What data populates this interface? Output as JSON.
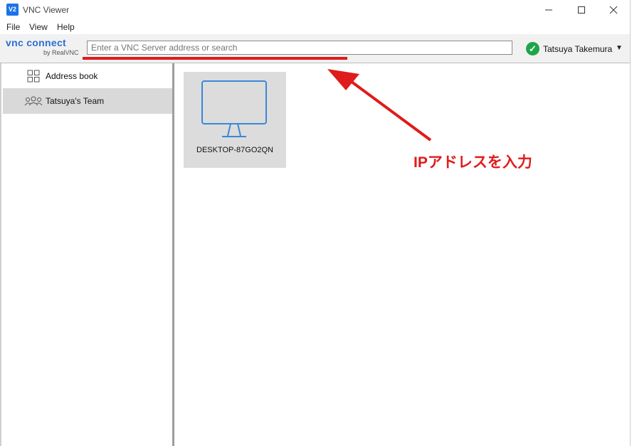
{
  "window": {
    "title": "VNC Viewer",
    "app_icon_text": "V2",
    "controls": [
      "minimize-icon",
      "maximize-icon",
      "close-icon"
    ]
  },
  "menu": {
    "file": "File",
    "view": "View",
    "help": "Help"
  },
  "toolbar": {
    "logo_main": "vnc connect",
    "logo_sub": "by RealVNC",
    "search_placeholder": "Enter a VNC Server address or search",
    "user_name": "Tatsuya Takemura",
    "user_status_color": "#1fa54a"
  },
  "sidebar": {
    "items": [
      {
        "label": "Address book",
        "icon": "grid-icon",
        "selected": false
      },
      {
        "label": "Tatsuya's Team",
        "icon": "team-icon",
        "selected": true
      }
    ]
  },
  "content": {
    "computers": [
      {
        "name": "DESKTOP-87GO2QN",
        "icon": "monitor-icon"
      }
    ]
  },
  "annotation": {
    "text": "IPアドレスを入力",
    "color": "#e01b1b"
  }
}
